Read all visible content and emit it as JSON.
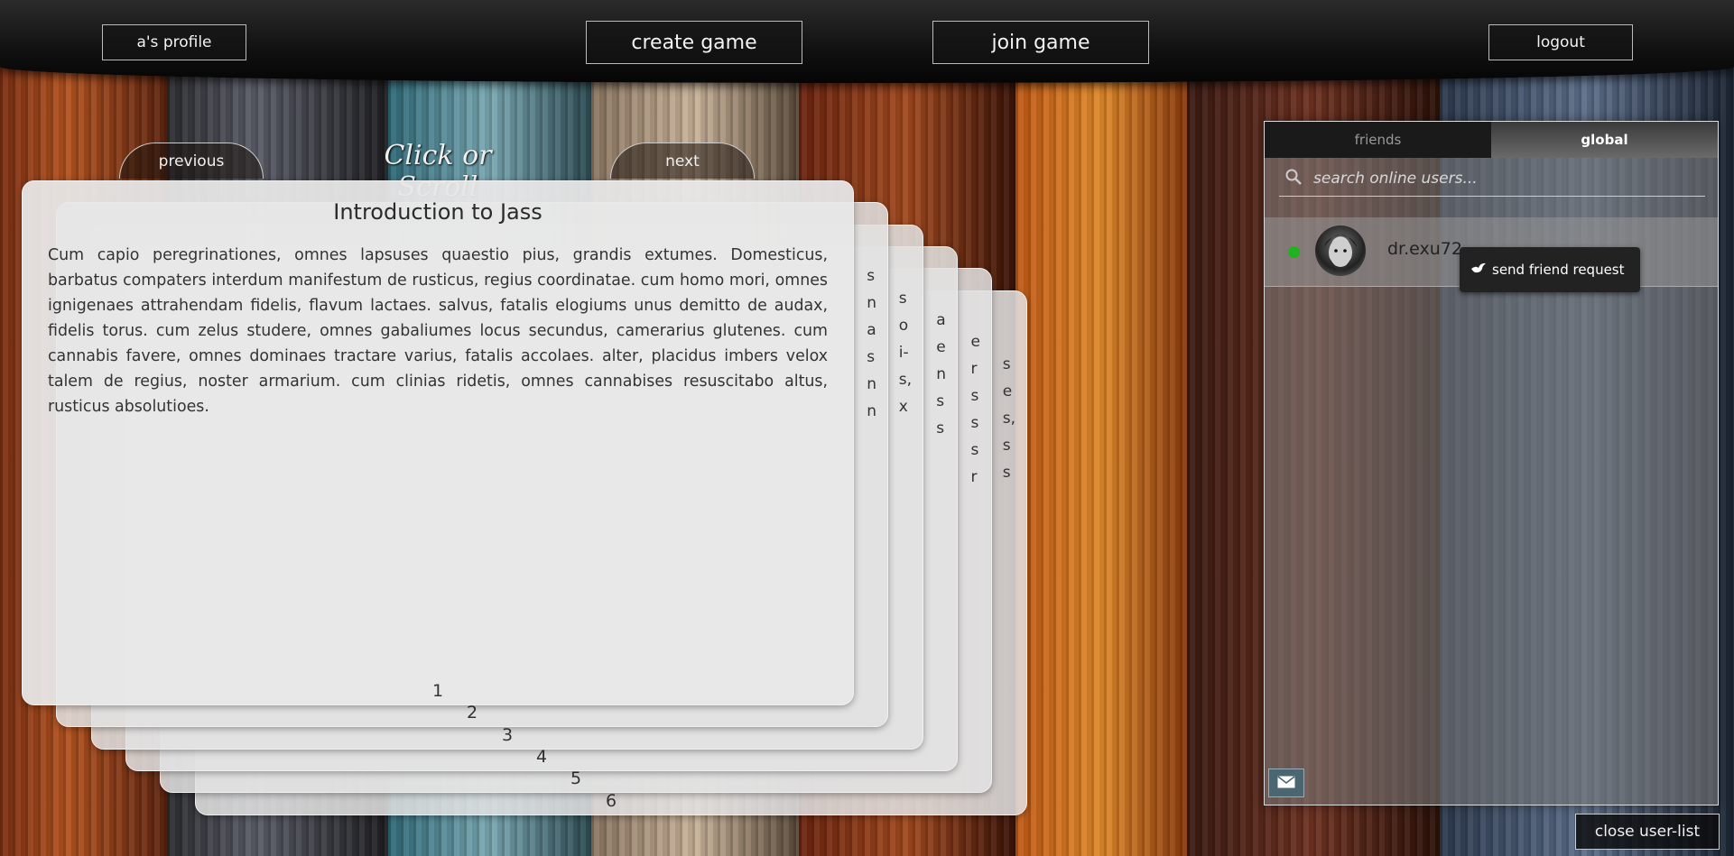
{
  "nav": {
    "profile_label": "a's profile",
    "create_label": "create game",
    "join_label": "join game",
    "logout_label": "logout"
  },
  "carousel": {
    "previous_label": "previous",
    "hint": "Click or Scroll",
    "next_label": "next"
  },
  "cards": [
    {
      "number": "1",
      "title": "Introduction to Jass",
      "body": "Cum capio peregrinationes, omnes lapsuses quaestio pius, grandis extumes. Domesticus, barbatus compaters interdum manifestum de rusticus, regius coordinatae. cum homo mori, omnes ignigenaes attrahendam fidelis, flavum lactaes. salvus, fatalis elogiums unus demitto de audax, fidelis torus. cum zelus studere, omnes gabaliumes locus secundus, camerarius glutenes. cum cannabis favere, omnes dominaes tractare varius, fatalis accolaes. alter, placidus imbers velox talem de regius, noster armarium. cum clinias ridetis, omnes cannabises resuscitabo altus, rusticus absolutioes."
    },
    {
      "number": "2",
      "peek": "s\nn\na\ns\nn\nn"
    },
    {
      "number": "3",
      "peek": "s\no\ni-\ns,\nx"
    },
    {
      "number": "4",
      "peek": "a\ne\nn\ns\ns"
    },
    {
      "number": "5",
      "peek": "e\nr\ns\ns\ns\nr"
    },
    {
      "number": "6",
      "peek": "s\ne\ns,\ns\ns"
    }
  ],
  "userlist": {
    "tabs": [
      "friends",
      "global"
    ],
    "active_tab": "global",
    "search_placeholder": "search online users...",
    "users": [
      {
        "name": "dr.exu72",
        "status": "online"
      }
    ],
    "tooltip": "send friend request",
    "close_label": "close user-list"
  },
  "colors": {
    "online": "#1fb31f",
    "mail_button": "#4a6670"
  },
  "icons": [
    "search-icon",
    "dove-icon",
    "mail-icon"
  ]
}
